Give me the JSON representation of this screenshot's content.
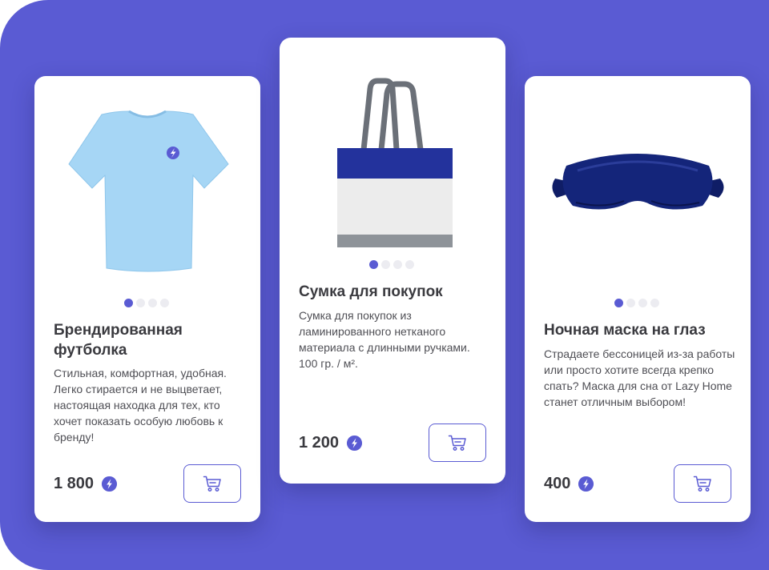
{
  "colors": {
    "background": "#5a5bd3",
    "accent": "#5a5bd3",
    "card": "#ffffff",
    "text": "#3a3a3f"
  },
  "icons": {
    "currency": "lightning-coin-icon",
    "cart": "shopping-cart-icon"
  },
  "products": [
    {
      "image": "light-blue-t-shirt",
      "title": "Брендированная футболка",
      "description": "Стильная, комфортная, удобная. Легко стирается и не выцветает, настоящая находка для тех, кто хочет показать особую любовь к бренду!",
      "price": "1 800",
      "carousel_slides": 4,
      "carousel_active": 1
    },
    {
      "image": "shopping-tote-bag",
      "title": "Сумка для покупок",
      "description": "Сумка для покупок из ламинированного нетканого материала с длинными ручками. 100 гр. / м².",
      "price": "1 200",
      "carousel_slides": 4,
      "carousel_active": 1
    },
    {
      "image": "navy-sleep-mask",
      "title": "Ночная маска на глаз",
      "description": "Страдаете бессоницей из-за работы или просто хотите всегда крепко спать? Маска для сна от Lazy Home станет отличным выбором!",
      "price": "400",
      "carousel_slides": 4,
      "carousel_active": 1
    }
  ]
}
